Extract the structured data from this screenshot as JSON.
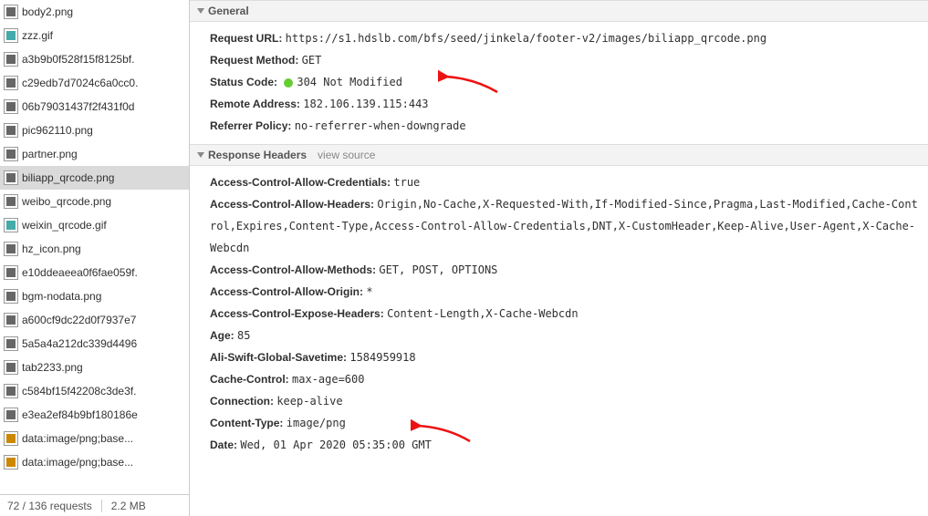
{
  "sidebar": {
    "items": [
      {
        "name": "body2.png",
        "type": "png"
      },
      {
        "name": "zzz.gif",
        "type": "gif"
      },
      {
        "name": "a3b9b0f528f15f8125bf.",
        "type": "png"
      },
      {
        "name": "c29edb7d7024c6a0cc0.",
        "type": "png"
      },
      {
        "name": "06b79031437f2f431f0d",
        "type": "png"
      },
      {
        "name": "pic962110.png",
        "type": "png"
      },
      {
        "name": "partner.png",
        "type": "png"
      },
      {
        "name": "biliapp_qrcode.png",
        "type": "png",
        "selected": true
      },
      {
        "name": "weibo_qrcode.png",
        "type": "png"
      },
      {
        "name": "weixin_qrcode.gif",
        "type": "gif"
      },
      {
        "name": "hz_icon.png",
        "type": "png"
      },
      {
        "name": "e10ddeaeea0f6fae059f.",
        "type": "png"
      },
      {
        "name": "bgm-nodata.png",
        "type": "png"
      },
      {
        "name": "a600cf9dc22d0f7937e7",
        "type": "png"
      },
      {
        "name": "5a5a4a212dc339d4496",
        "type": "png"
      },
      {
        "name": "tab2233.png",
        "type": "png"
      },
      {
        "name": "c584bf15f42208c3de3f.",
        "type": "png"
      },
      {
        "name": "e3ea2ef84b9bf180186e",
        "type": "png"
      },
      {
        "name": "data:image/png;base...",
        "type": "data"
      },
      {
        "name": "data:image/png;base...",
        "type": "data"
      }
    ]
  },
  "status": {
    "requests": "72 / 136 requests",
    "size": "2.2 MB"
  },
  "sections": {
    "general": {
      "title": "General",
      "rows": [
        {
          "key": "Request URL:",
          "val": "https://s1.hdslb.com/bfs/seed/jinkela/footer-v2/images/biliapp_qrcode.png"
        },
        {
          "key": "Request Method:",
          "val": "GET"
        },
        {
          "key": "Status Code:",
          "val": "304 Not Modified",
          "dot": true
        },
        {
          "key": "Remote Address:",
          "val": "182.106.139.115:443"
        },
        {
          "key": "Referrer Policy:",
          "val": "no-referrer-when-downgrade"
        }
      ]
    },
    "response": {
      "title": "Response Headers",
      "viewsource": "view source",
      "rows": [
        {
          "key": "Access-Control-Allow-Credentials:",
          "val": "true"
        },
        {
          "key": "Access-Control-Allow-Headers:",
          "val": "Origin,No-Cache,X-Requested-With,If-Modified-Since,Pragma,Last-Modified,Cache-Control,Expires,Content-Type,Access-Control-Allow-Credentials,DNT,X-CustomHeader,Keep-Alive,User-Agent,X-Cache-Webcdn"
        },
        {
          "key": "Access-Control-Allow-Methods:",
          "val": "GET, POST, OPTIONS"
        },
        {
          "key": "Access-Control-Allow-Origin:",
          "val": "*"
        },
        {
          "key": "Access-Control-Expose-Headers:",
          "val": "Content-Length,X-Cache-Webcdn"
        },
        {
          "key": "Age:",
          "val": "85"
        },
        {
          "key": "Ali-Swift-Global-Savetime:",
          "val": "1584959918"
        },
        {
          "key": "Cache-Control:",
          "val": "max-age=600"
        },
        {
          "key": "Connection:",
          "val": "keep-alive"
        },
        {
          "key": "Content-Type:",
          "val": "image/png"
        },
        {
          "key": "Date:",
          "val": "Wed, 01 Apr 2020 05:35:00 GMT"
        }
      ]
    }
  }
}
